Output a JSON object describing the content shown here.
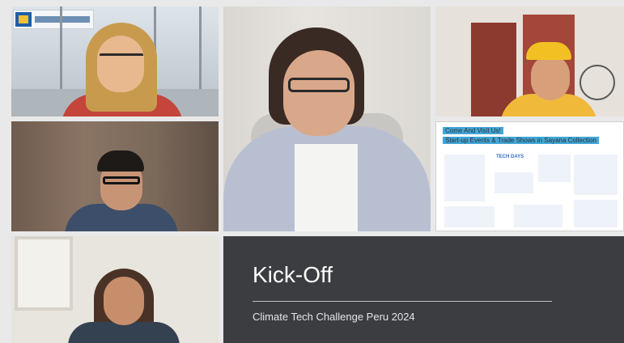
{
  "slide": {
    "headline_line1": "Come And Visit Us!",
    "headline_line2": "Start-up Events & Trade Shows in Sayana Collection",
    "logos": [
      "TECH DAYS"
    ]
  },
  "title_card": {
    "title": "Kick-Off",
    "subtitle": "Climate Tech Challenge Peru 2024"
  }
}
